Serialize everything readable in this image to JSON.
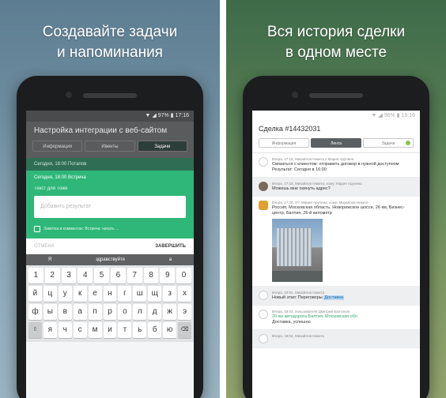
{
  "left": {
    "headline": [
      "Создавайте задачи",
      "и напоминания"
    ],
    "status_time": "▼ ◢ 97% ▮ 17:16",
    "task_title": "Настройка интеграции с веб-сайтом",
    "tabs": [
      "Информация",
      "Ивенты",
      "Задачи"
    ],
    "strip": "Сегодня, 18:00    Потапов",
    "green_line1": "Сегодня, 18:00    Встреча",
    "green_line2": "Текст для Тоже",
    "result_placeholder": "Добавить результат",
    "checkbox_label": "Заметка в комментах: Встреча: начать ...",
    "cancel": "ОТМЕНА",
    "done": "ЗАВЕРШИТЬ",
    "keyboard_top": [
      "Я",
      "здравствуйте",
      "а"
    ],
    "keys_row1": [
      "1",
      "2",
      "3",
      "4",
      "5",
      "6",
      "7",
      "8",
      "9",
      "0"
    ],
    "keys_row2": [
      "й",
      "ц",
      "у",
      "к",
      "е",
      "н",
      "г",
      "ш",
      "щ",
      "з",
      "х"
    ],
    "keys_row3": [
      "ф",
      "ы",
      "в",
      "а",
      "п",
      "р",
      "о",
      "л",
      "д",
      "ж",
      "э"
    ],
    "keys_row4": [
      "⇧",
      "я",
      "ч",
      "с",
      "м",
      "и",
      "т",
      "ь",
      "б",
      "ю",
      "⌫"
    ]
  },
  "right": {
    "headline": [
      "Вся история сделки",
      "в одном месте"
    ],
    "status_time": "▼ ◢ 96% ▮ 18:16",
    "deal_title": "Сделка #14432031",
    "tabs": [
      "Информация",
      "Лента",
      "Задачи"
    ],
    "feed": [
      {
        "meta": "Вчера, 17:16, Михайлов Никита к Мария Арупина",
        "text": "Связаться с клиентом: отправить договор в нужной доступном",
        "extra": "Результат: Сегодня в 16:00"
      },
      {
        "meta": "Вчера, 17:18, Михайлов Никита, кому: Мария Арупина",
        "text": "Можешь мне скинуть адрес?"
      },
      {
        "meta": "Вчера, 17:20, От: Мария Арупина, кому: Михайлов Никита",
        "text": "Россия, Московская область, Новорижское шоссе, 26 км, Бизнес-центр, Балтия, 26-й километр"
      },
      {
        "meta": "Вчера, 18:01, Михайлов Никита",
        "text": "Новый этап:",
        "before": "Переговоры",
        "after": "Доставка"
      },
      {
        "meta": "Вчера, 18:03, пользователя Дмитрий Балтахов",
        "text": "20 км автодорога Балтия, Московская обл",
        "extra": "Доставка, успешно"
      },
      {
        "meta": "Вчера, 18:04, Михайлов Никита",
        "text": ""
      }
    ]
  }
}
